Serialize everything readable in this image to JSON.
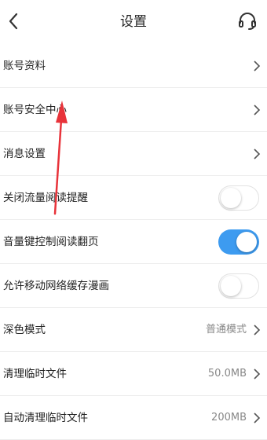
{
  "header": {
    "title": "设置",
    "back_icon": "chevron-left-icon",
    "support_icon": "headset-icon"
  },
  "colors": {
    "toggle_on": "#3d9bf0",
    "annotation_arrow": "#e8333a"
  },
  "settings": [
    {
      "label": "账号资料",
      "kind": "link"
    },
    {
      "label": "账号安全中心",
      "kind": "link"
    },
    {
      "label": "消息设置",
      "kind": "link"
    },
    {
      "label": "关闭流量阅读提醒",
      "kind": "toggle",
      "on": false
    },
    {
      "label": "音量键控制阅读翻页",
      "kind": "toggle",
      "on": true
    },
    {
      "label": "允许移动网络缓存漫画",
      "kind": "toggle",
      "on": false
    },
    {
      "label": "深色模式",
      "kind": "link",
      "value": "普通模式"
    },
    {
      "label": "清理临时文件",
      "kind": "link",
      "value": "50.0MB"
    },
    {
      "label": "自动清理临时文件",
      "kind": "link",
      "value": "200MB"
    }
  ]
}
